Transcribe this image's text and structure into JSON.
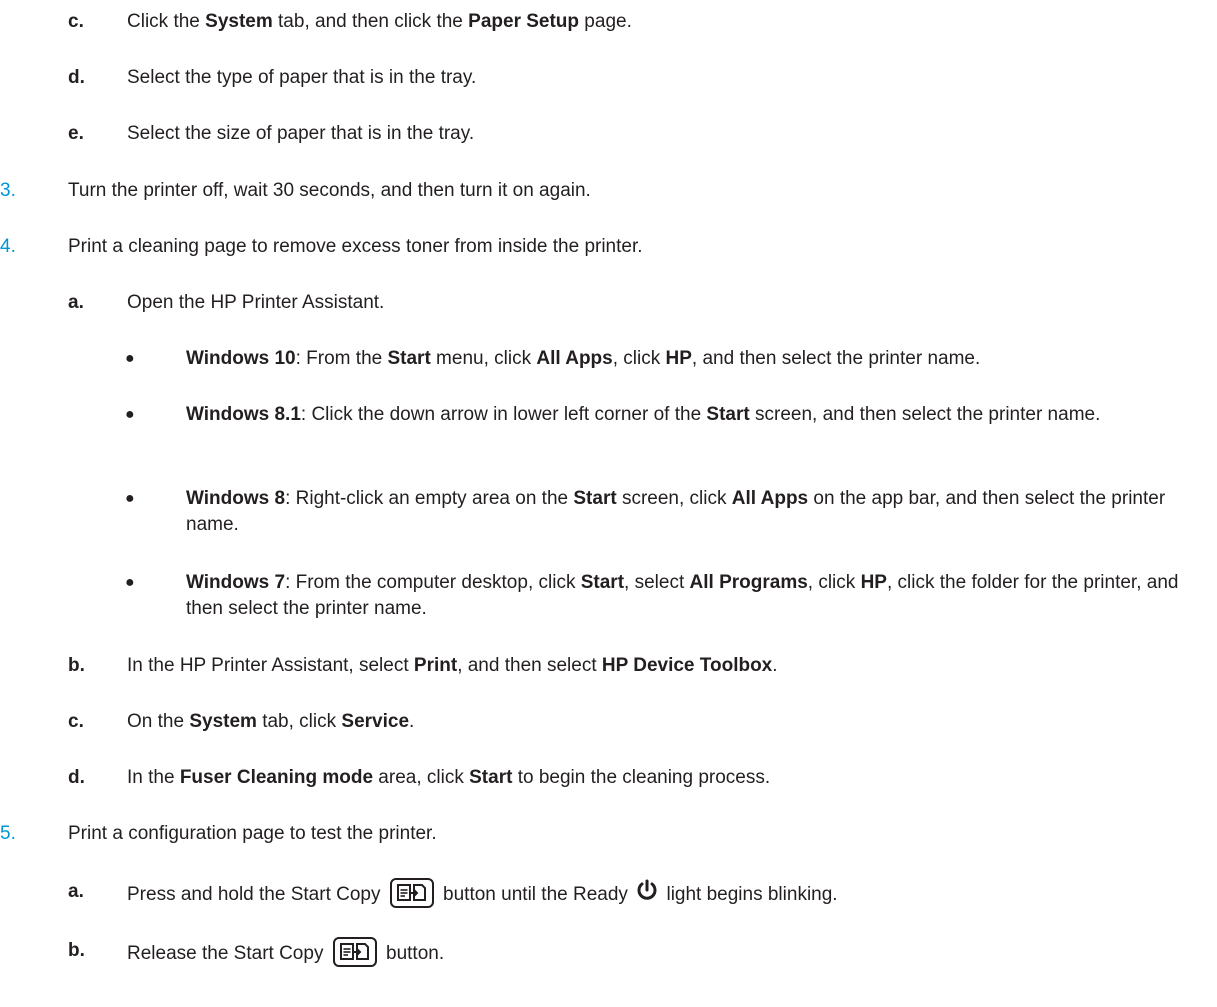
{
  "step2_substeps": [
    {
      "letter": "c.",
      "parts": [
        [
          "t",
          "Click the "
        ],
        [
          "b",
          "System"
        ],
        [
          "t",
          " tab, and then click the "
        ],
        [
          "b",
          "Paper Setup"
        ],
        [
          "t",
          " page."
        ]
      ]
    },
    {
      "letter": "d.",
      "parts": [
        [
          "t",
          "Select the type of paper that is in the tray."
        ]
      ]
    },
    {
      "letter": "e.",
      "parts": [
        [
          "t",
          "Select the size of paper that is in the tray."
        ]
      ]
    }
  ],
  "step3": {
    "number": "3.",
    "text": "Turn the printer off, wait 30 seconds, and then turn it on again."
  },
  "step4": {
    "number": "4.",
    "text": "Print a cleaning page to remove excess toner from inside the printer.",
    "a": {
      "letter": "a.",
      "text": "Open the HP Printer Assistant."
    },
    "bullets": [
      [
        [
          "b",
          "Windows 10"
        ],
        [
          "t",
          ": From the "
        ],
        [
          "b",
          "Start"
        ],
        [
          "t",
          " menu, click "
        ],
        [
          "b",
          "All Apps"
        ],
        [
          "t",
          ", click "
        ],
        [
          "b",
          "HP"
        ],
        [
          "t",
          ", and then select the printer name."
        ]
      ],
      [
        [
          "b",
          "Windows 8.1"
        ],
        [
          "t",
          ": Click the down arrow in lower left corner of the "
        ],
        [
          "b",
          "Start"
        ],
        [
          "t",
          " screen, and then select the printer name."
        ]
      ],
      [
        [
          "b",
          "Windows 8"
        ],
        [
          "t",
          ": Right-click an empty area on the "
        ],
        [
          "b",
          "Start"
        ],
        [
          "t",
          " screen, click "
        ],
        [
          "b",
          "All Apps"
        ],
        [
          "t",
          " on the app bar, and then select the printer name."
        ]
      ],
      [
        [
          "b",
          "Windows 7"
        ],
        [
          "t",
          ": From the computer desktop, click "
        ],
        [
          "b",
          "Start"
        ],
        [
          "t",
          ", select "
        ],
        [
          "b",
          "All Programs"
        ],
        [
          "t",
          ", click "
        ],
        [
          "b",
          "HP"
        ],
        [
          "t",
          ", click the folder for the printer, and then select the printer name."
        ]
      ]
    ],
    "b": {
      "letter": "b.",
      "parts": [
        [
          "t",
          "In the HP Printer Assistant, select "
        ],
        [
          "b",
          "Print"
        ],
        [
          "t",
          ", and then select "
        ],
        [
          "b",
          "HP Device Toolbox"
        ],
        [
          "t",
          "."
        ]
      ]
    },
    "c": {
      "letter": "c.",
      "parts": [
        [
          "t",
          "On the "
        ],
        [
          "b",
          "System"
        ],
        [
          "t",
          " tab, click "
        ],
        [
          "b",
          "Service"
        ],
        [
          "t",
          "."
        ]
      ]
    },
    "d": {
      "letter": "d.",
      "parts": [
        [
          "t",
          "In the "
        ],
        [
          "b",
          "Fuser Cleaning mode"
        ],
        [
          "t",
          " area, click "
        ],
        [
          "b",
          "Start"
        ],
        [
          "t",
          " to begin the cleaning process."
        ]
      ]
    }
  },
  "step5": {
    "number": "5.",
    "text": "Print a configuration page to test the printer.",
    "a": {
      "letter": "a.",
      "before": "Press and hold the Start Copy",
      "middle": "button until the Ready",
      "after": "light begins blinking."
    },
    "b": {
      "letter": "b.",
      "before": "Release the Start Copy",
      "after": "button."
    }
  },
  "icons": {
    "copy": "start-copy-icon",
    "power": "ready-power-icon"
  },
  "colors": {
    "step_number": "#0096d6",
    "text": "#231f20"
  }
}
